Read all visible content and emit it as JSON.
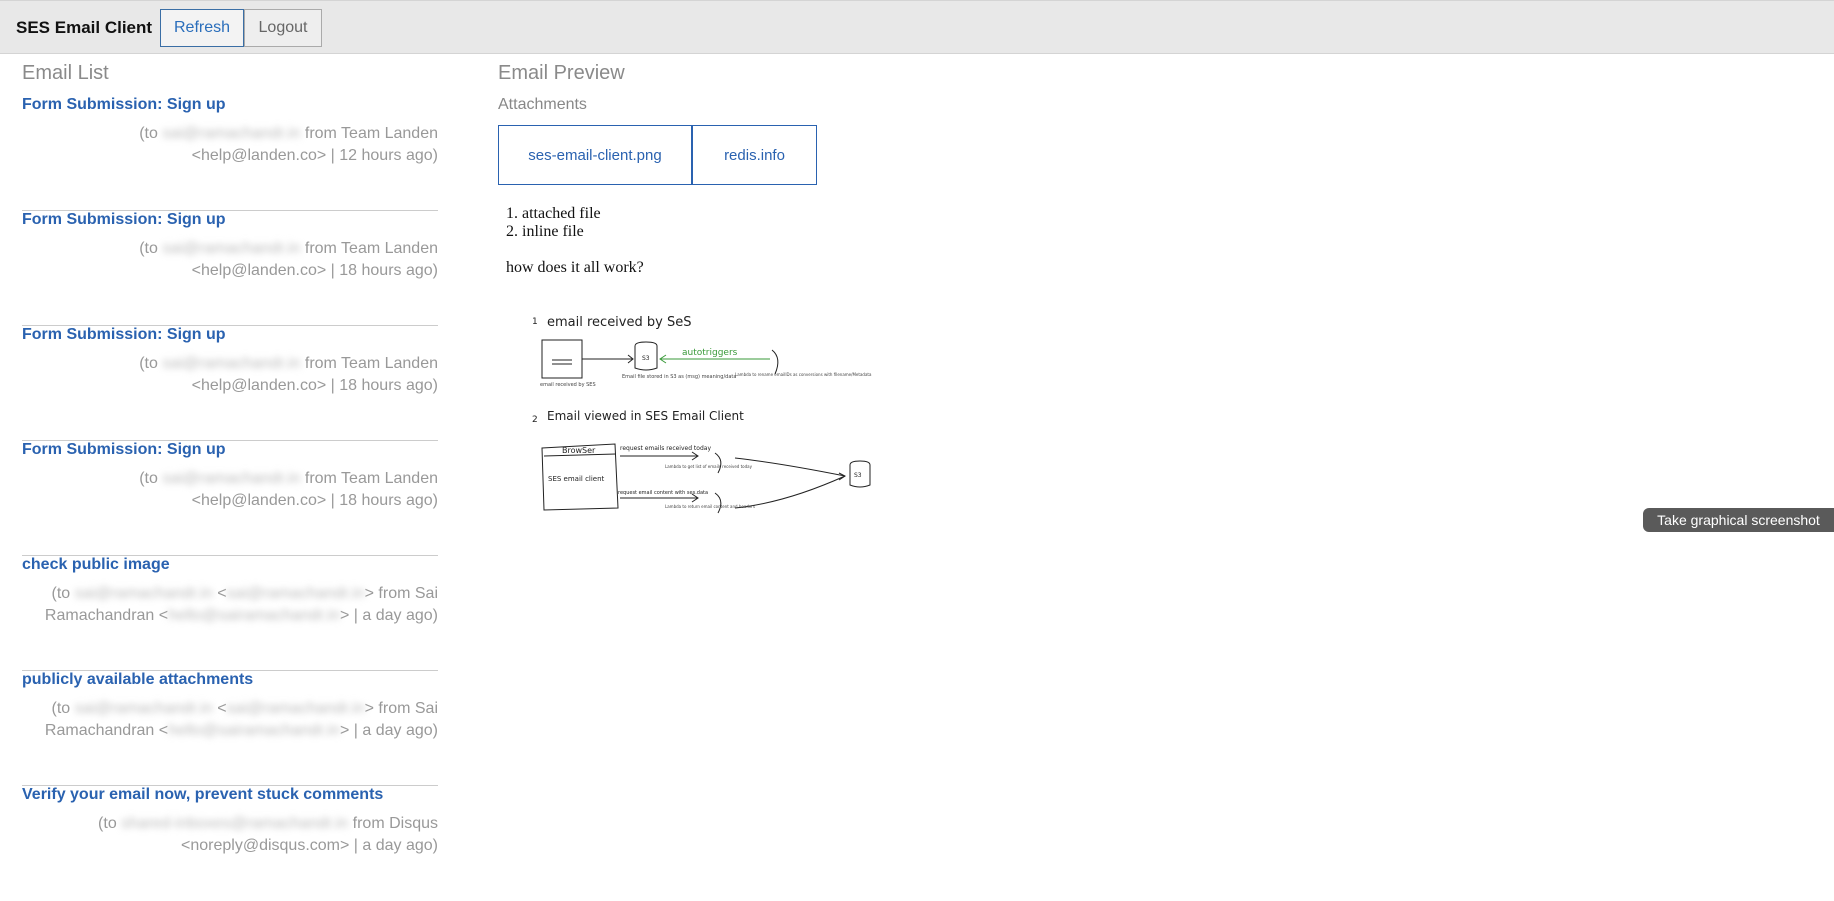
{
  "app": {
    "title": "SES Email Client"
  },
  "toolbar": {
    "refresh_label": "Refresh",
    "logout_label": "Logout"
  },
  "email_list": {
    "title": "Email List",
    "items": [
      {
        "subject": "Form Submission: Sign up",
        "to_prefix": "(to ",
        "to": "sai@ramachandr.in",
        "line1_rest": " from Team Landen",
        "line2": "<help@landen.co> | 12 hours ago)"
      },
      {
        "subject": "Form Submission: Sign up",
        "to_prefix": "(to ",
        "to": "sai@ramachandr.in",
        "line1_rest": " from Team Landen",
        "line2": "<help@landen.co> | 18 hours ago)"
      },
      {
        "subject": "Form Submission: Sign up",
        "to_prefix": "(to ",
        "to": "sai@ramachandr.in",
        "line1_rest": " from Team Landen",
        "line2": "<help@landen.co> | 18 hours ago)"
      },
      {
        "subject": "Form Submission: Sign up",
        "to_prefix": "(to ",
        "to": "sai@ramachandr.in",
        "line1_rest": " from Team Landen",
        "line2": "<help@landen.co> | 18 hours ago)"
      },
      {
        "subject": "check public image",
        "to_prefix": "(to ",
        "to": "sai@ramachandr.in",
        "mid": " <",
        "to2": "sai@ramachandr.in",
        "line1_rest": "> from Sai",
        "line2_prefix": "Ramachandran <",
        "line2_blur": "hello@sairamachandr.in",
        "line2": "> | a day ago)"
      },
      {
        "subject": "publicly available attachments",
        "to_prefix": "(to ",
        "to": "sai@ramachandr.in",
        "mid": " <",
        "to2": "sai@ramachandr.in",
        "line1_rest": "> from Sai",
        "line2_prefix": "Ramachandran <",
        "line2_blur": "hello@sairamachandr.in",
        "line2": "> | a day ago)"
      },
      {
        "subject": "Verify your email now, prevent stuck comments",
        "to_prefix": "(to ",
        "to": "shared-inboxes@ramachandr.in",
        "line1_rest": " from Disqus",
        "line2": "<noreply@disqus.com> | a day ago)"
      }
    ]
  },
  "preview": {
    "title": "Email Preview",
    "attachments_label": "Attachments",
    "attachments": [
      "ses-email-client.png",
      "redis.info"
    ],
    "list_items": [
      "attached file",
      "inline file"
    ],
    "paragraph": "how does it all work?",
    "diagram": {
      "step1_num": "1",
      "step1_title": "email received by SeS",
      "step1_autotriggers": "autotriggers",
      "step1_caption_a": "email received by SES",
      "step1_caption_b": "Email file stored in S3 as (msg) meaning/data",
      "step1_caption_c": "Lambda to rename emailIDs as conversions with filename/Metadata",
      "step2_num": "2",
      "step2_title": "Email viewed  in SES Email Client",
      "step2_browser": "BrowSer",
      "step2_client": "SES email client",
      "step2_req1": "request emails received today",
      "step2_req2": "request email content with ses.data",
      "step2_lambda1": "Lambda to get list of emails received today",
      "step2_lambda2": "Lambda to return email content and headers",
      "step2_s3": "S3"
    }
  },
  "tooltip": {
    "label": "Take graphical screenshot"
  }
}
